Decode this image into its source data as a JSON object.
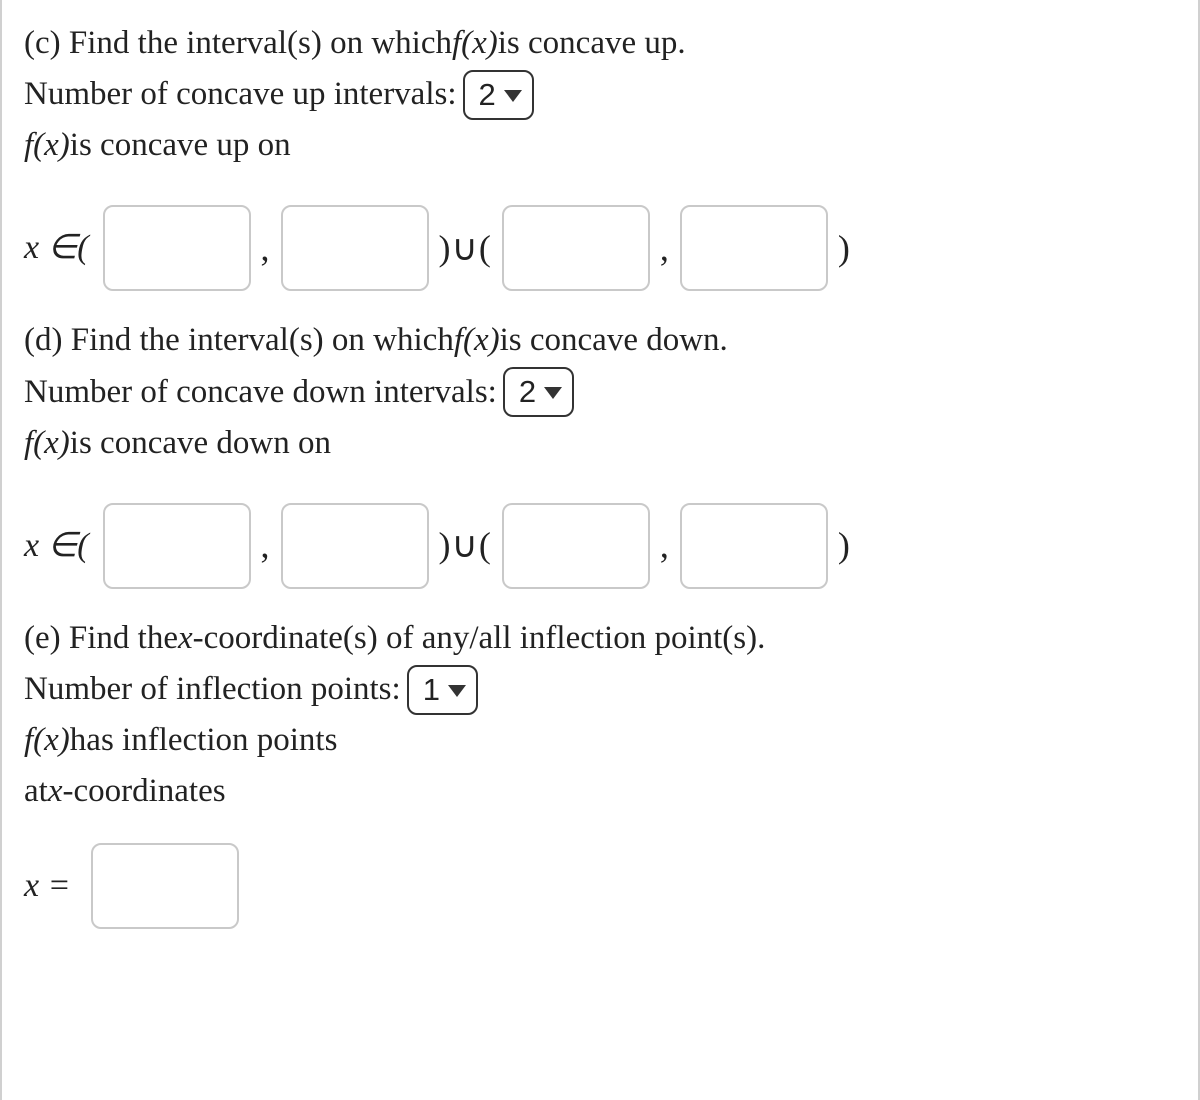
{
  "c": {
    "prompt_pre": "(c) Find the interval(s) on which ",
    "fx": "f(x)",
    "prompt_post": " is concave up.",
    "count_label": "Number of concave up intervals:",
    "count_value": "2",
    "result_pre": " is concave up on",
    "lead": "x ∈(",
    "comma": ",",
    "union": ")∪(",
    "close": ")"
  },
  "d": {
    "prompt_pre": "(d) Find the interval(s) on which ",
    "fx": "f(x)",
    "prompt_post": " is concave down.",
    "count_label": "Number of concave down intervals:",
    "count_value": "2",
    "result_pre": " is concave down on",
    "lead": "x ∈(",
    "comma": ",",
    "union": ")∪(",
    "close": ")"
  },
  "e": {
    "prompt_pre": "(e) Find the ",
    "xvar": "x",
    "prompt_mid": "-coordinate(s) of any/all inflection point(s).",
    "count_label": "Number of inflection points:",
    "count_value": "1",
    "fx": "f(x)",
    "result_line1_post": " has inflection points",
    "result_line2_pre": "at ",
    "result_line2_post": "-coordinates",
    "lead": "x =",
    "comma": ""
  }
}
